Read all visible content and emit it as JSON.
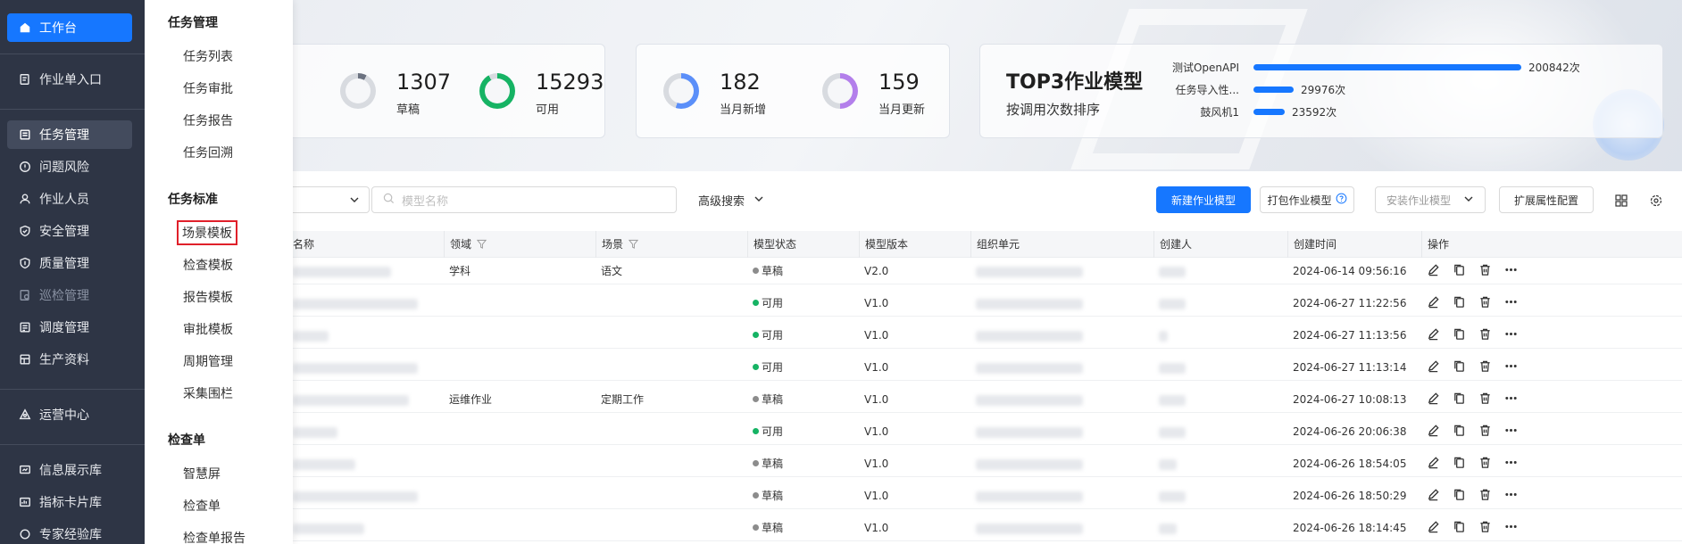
{
  "sidebar": {
    "items": [
      {
        "label": "工作台",
        "icon": "home-icon"
      },
      {
        "label": "作业单入口",
        "icon": "form-icon"
      },
      {
        "label": "任务管理",
        "icon": "task-icon"
      },
      {
        "label": "问题风险",
        "icon": "alert-icon"
      },
      {
        "label": "作业人员",
        "icon": "users-icon"
      },
      {
        "label": "安全管理",
        "icon": "shield-icon"
      },
      {
        "label": "质量管理",
        "icon": "quality-icon"
      },
      {
        "label": "巡检管理",
        "icon": "inspect-icon"
      },
      {
        "label": "调度管理",
        "icon": "dispatch-icon"
      },
      {
        "label": "生产资料",
        "icon": "material-icon"
      },
      {
        "label": "运营中心",
        "icon": "operation-icon"
      },
      {
        "label": "信息展示库",
        "icon": "display-icon"
      },
      {
        "label": "指标卡片库",
        "icon": "card-icon"
      },
      {
        "label": "专家经验库",
        "icon": "expert-icon"
      }
    ]
  },
  "submenu": {
    "groups": [
      {
        "title": "任务管理",
        "items": [
          "任务列表",
          "任务审批",
          "任务报告",
          "任务回溯"
        ]
      },
      {
        "title": "任务标准",
        "items": [
          "场景模板",
          "检查模板",
          "报告模板",
          "审批模板",
          "周期管理",
          "采集围栏"
        ]
      },
      {
        "title": "检查单",
        "items": [
          "智慧屏",
          "检查单",
          "检查单报告"
        ]
      }
    ]
  },
  "stats": {
    "draft": {
      "value": "1307",
      "label": "草稿"
    },
    "available": {
      "value": "15293",
      "label": "可用"
    },
    "month_new": {
      "value": "182",
      "label": "当月新增"
    },
    "month_update": {
      "value": "159",
      "label": "当月更新"
    }
  },
  "top3": {
    "title": "TOP3作业模型",
    "subtitle": "按调用次数排序",
    "items": [
      {
        "name": "测试OpenAPI",
        "value": "200842次",
        "fraction": 1.0
      },
      {
        "name": "任务导入性...",
        "value": "29976次",
        "fraction": 0.149
      },
      {
        "name": "鼓风机1",
        "value": "23592次",
        "fraction": 0.117
      }
    ]
  },
  "toolbar": {
    "search_placeholder": "模型名称",
    "advanced_search": "高级搜索",
    "new_button": "新建作业模型",
    "pack_button": "打包作业模型",
    "install_button": "安装作业模型",
    "extend_button": "扩展属性配置"
  },
  "table": {
    "headers": [
      "名称",
      "领域",
      "场景",
      "模型状态",
      "模型版本",
      "组织单元",
      "创建人",
      "创建时间",
      "操作"
    ],
    "rows": [
      {
        "name": "",
        "domain": "学科",
        "scene": "语文",
        "status": "草稿",
        "version": "V2.0",
        "time": "2024-06-14 09:56:16"
      },
      {
        "name": "",
        "domain": "",
        "scene": "",
        "status": "可用",
        "version": "V1.0",
        "time": "2024-06-27 11:22:56"
      },
      {
        "name": "",
        "domain": "",
        "scene": "",
        "status": "可用",
        "version": "V1.0",
        "time": "2024-06-27 11:13:56"
      },
      {
        "name": "",
        "domain": "",
        "scene": "",
        "status": "可用",
        "version": "V1.0",
        "time": "2024-06-27 11:13:14"
      },
      {
        "name": "",
        "domain": "运维作业",
        "scene": "定期工作",
        "status": "草稿",
        "version": "V1.0",
        "time": "2024-06-27 10:08:13"
      },
      {
        "name": "",
        "domain": "",
        "scene": "",
        "status": "可用",
        "version": "V1.0",
        "time": "2024-06-26 20:06:38"
      },
      {
        "name": "",
        "domain": "",
        "scene": "",
        "status": "草稿",
        "version": "V1.0",
        "time": "2024-06-26 18:54:05"
      },
      {
        "name": "",
        "domain": "",
        "scene": "",
        "status": "草稿",
        "version": "V1.0",
        "time": "2024-06-26 18:50:29"
      },
      {
        "name": "",
        "domain": "",
        "scene": "",
        "status": "草稿",
        "version": "V1.0",
        "time": "2024-06-26 18:14:45"
      }
    ]
  },
  "colors": {
    "accent": "#1677ff",
    "status_available": "#16b364",
    "status_draft": "#8c8c8c",
    "highlight": "#e0202a"
  }
}
